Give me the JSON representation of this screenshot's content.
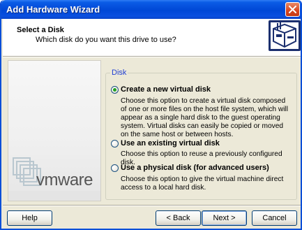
{
  "window": {
    "title": "Add Hardware Wizard"
  },
  "header": {
    "title": "Select a Disk",
    "subtitle": "Which disk do you want this drive to use?"
  },
  "banner": {
    "brand": "vmware"
  },
  "group": {
    "label": "Disk",
    "options": [
      {
        "label": "Create a new virtual disk",
        "selected": true,
        "description": "Choose this option to create a virtual disk composed of one or more files on the host file system, which will appear as a single hard disk to the guest operating system. Virtual disks can easily be copied or moved on the same host or between hosts."
      },
      {
        "label": "Use an existing virtual disk",
        "selected": false,
        "description": "Choose this option to reuse a previously configured disk."
      },
      {
        "label": "Use a physical disk (for advanced users)",
        "selected": false,
        "description": "Choose this option to give the virtual machine direct access to a local hard disk."
      }
    ]
  },
  "buttons": {
    "help": "Help",
    "back": "< Back",
    "next": "Next >",
    "cancel": "Cancel"
  },
  "icons": {
    "close": "close-icon",
    "header": "disk-drive-icon"
  }
}
